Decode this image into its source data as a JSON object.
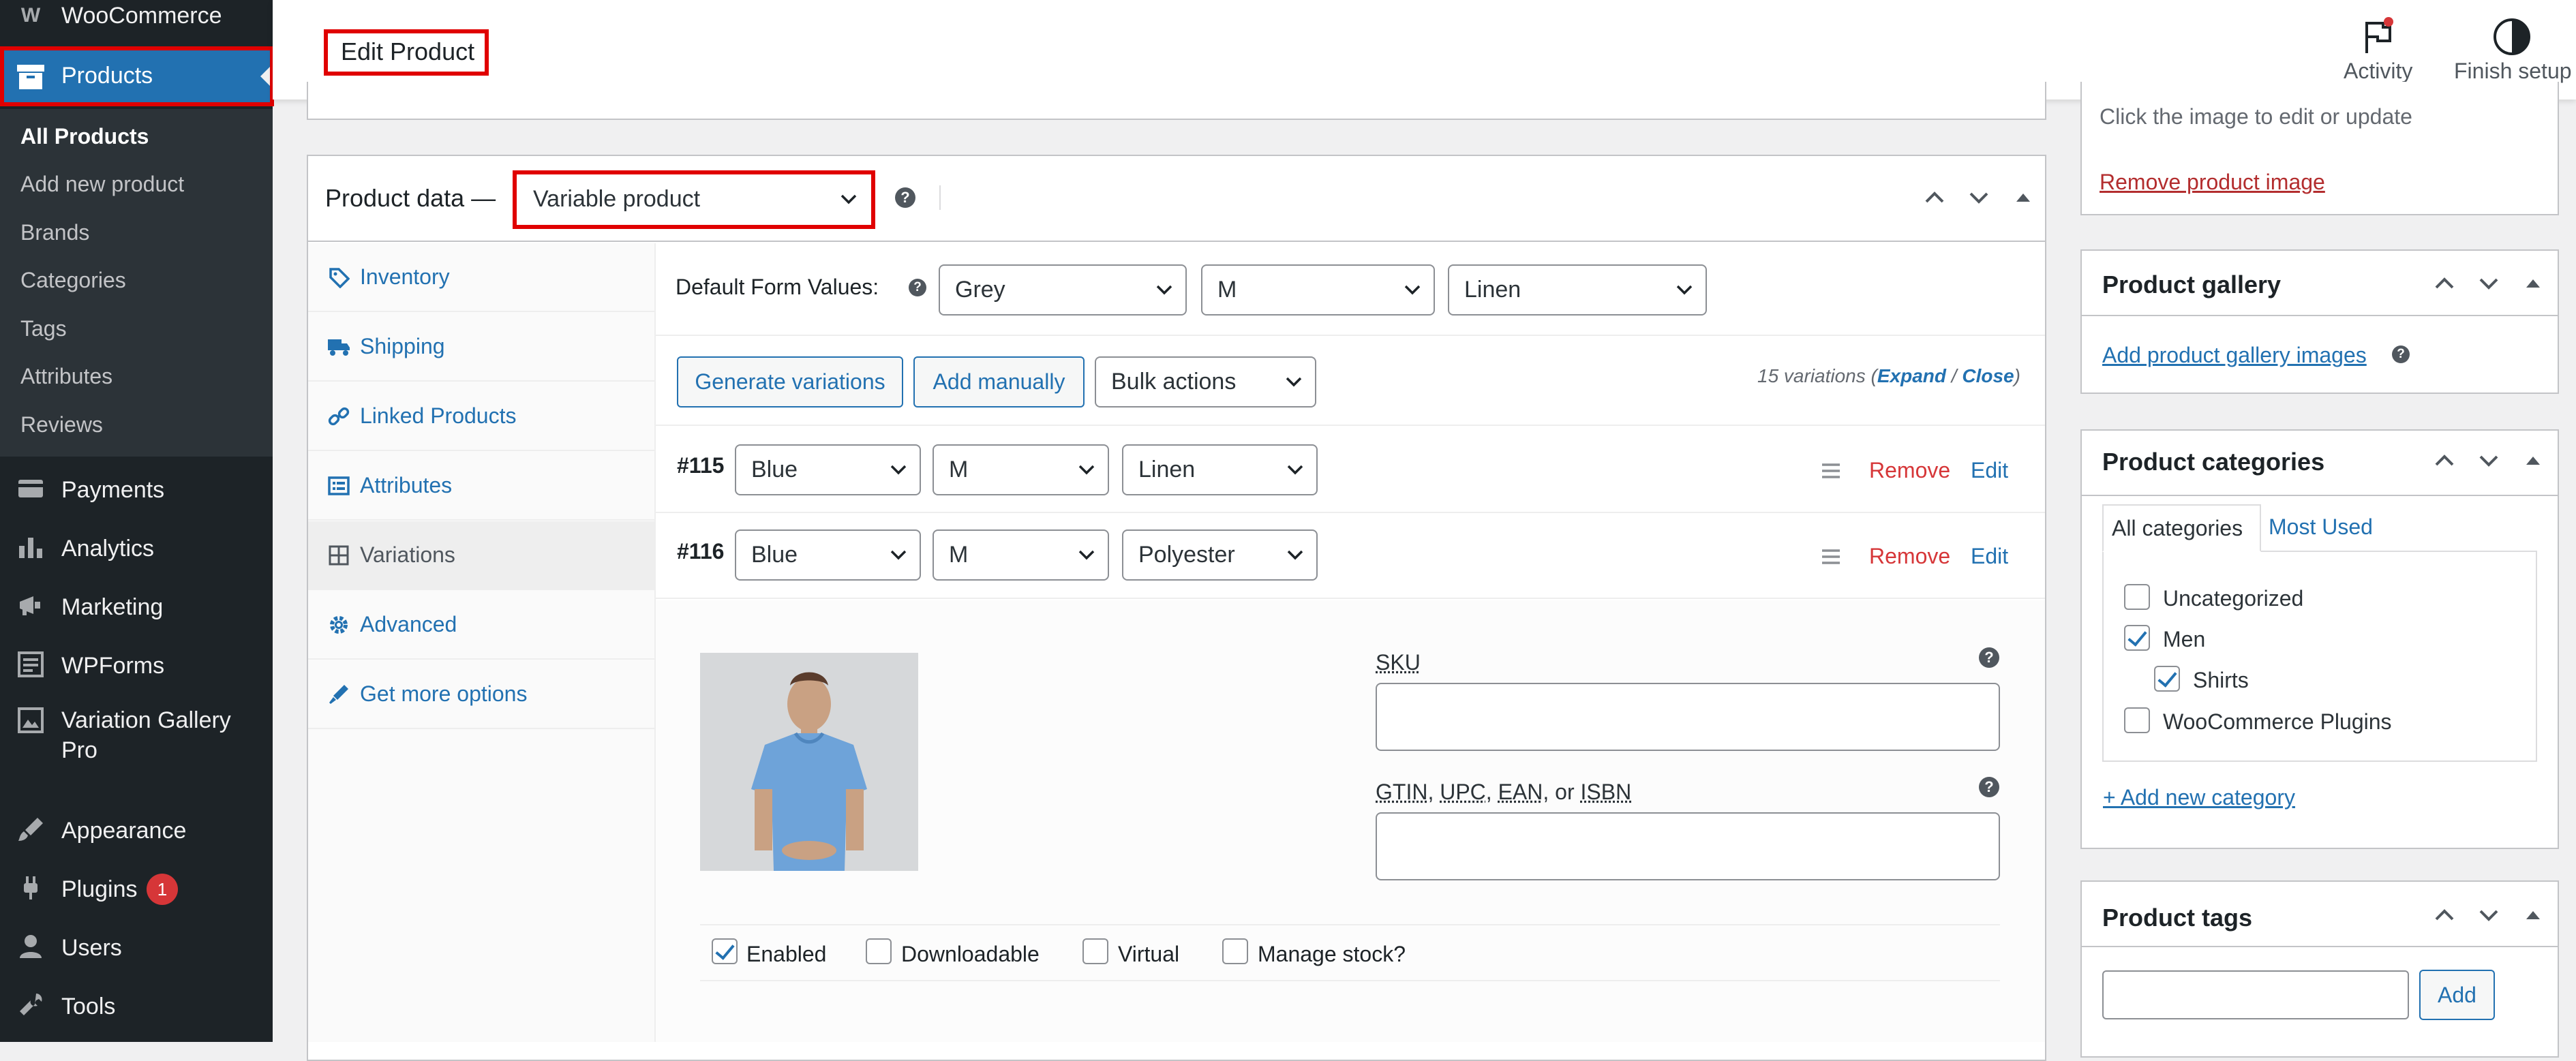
{
  "sidebar": {
    "brand": "WooCommerce",
    "products": "Products",
    "sub_items": [
      "All Products",
      "Add new product",
      "Brands",
      "Categories",
      "Tags",
      "Attributes",
      "Reviews"
    ],
    "payments": "Payments",
    "analytics": "Analytics",
    "marketing": "Marketing",
    "wpforms": "WPForms",
    "variation_gallery_line1": "Variation Gallery",
    "variation_gallery_line2": "Pro",
    "appearance": "Appearance",
    "plugins": "Plugins",
    "plugins_badge": "1",
    "users": "Users",
    "tools": "Tools"
  },
  "header": {
    "title": "Edit Product",
    "activity": "Activity",
    "finish_setup": "Finish setup"
  },
  "product_data": {
    "label": "Product data —",
    "type": "Variable product",
    "tabs": [
      "Inventory",
      "Shipping",
      "Linked Products",
      "Attributes",
      "Variations",
      "Advanced",
      "Get more options"
    ],
    "default_form_label": "Default Form Values:",
    "defaults": [
      "Grey",
      "M",
      "Linen"
    ],
    "generate_label": "Generate variations",
    "add_manually_label": "Add manually",
    "bulk_actions": "Bulk actions",
    "variations_count": "15 variations",
    "expand": "Expand",
    "close": "Close",
    "variations": [
      {
        "id": "#115",
        "color": "Blue",
        "size": "M",
        "material": "Linen"
      },
      {
        "id": "#116",
        "color": "Blue",
        "size": "M",
        "material": "Polyester"
      }
    ],
    "remove": "Remove",
    "edit": "Edit",
    "sku_label": "SKU",
    "gtin_label_parts": [
      "GTIN",
      "UPC",
      "EAN",
      "ISBN"
    ],
    "gtin_sep": ", ",
    "gtin_or": ", or ",
    "enabled": "Enabled",
    "downloadable": "Downloadable",
    "virtual": "Virtual",
    "manage_stock": "Manage stock?"
  },
  "right": {
    "image_hint": "Click the image to edit or update",
    "remove_image": "Remove product image",
    "gallery_title": "Product gallery",
    "gallery_add": "Add product gallery images",
    "cat_title": "Product categories",
    "cat_tab_all": "All categories",
    "cat_tab_most": "Most Used",
    "categories": [
      {
        "name": "Uncategorized",
        "checked": false
      },
      {
        "name": "Men",
        "checked": true
      },
      {
        "name": "Shirts",
        "checked": true
      },
      {
        "name": "WooCommerce Plugins",
        "checked": false
      }
    ],
    "add_category": "+ Add new category",
    "tags_title": "Product tags",
    "tags_add": "Add"
  }
}
